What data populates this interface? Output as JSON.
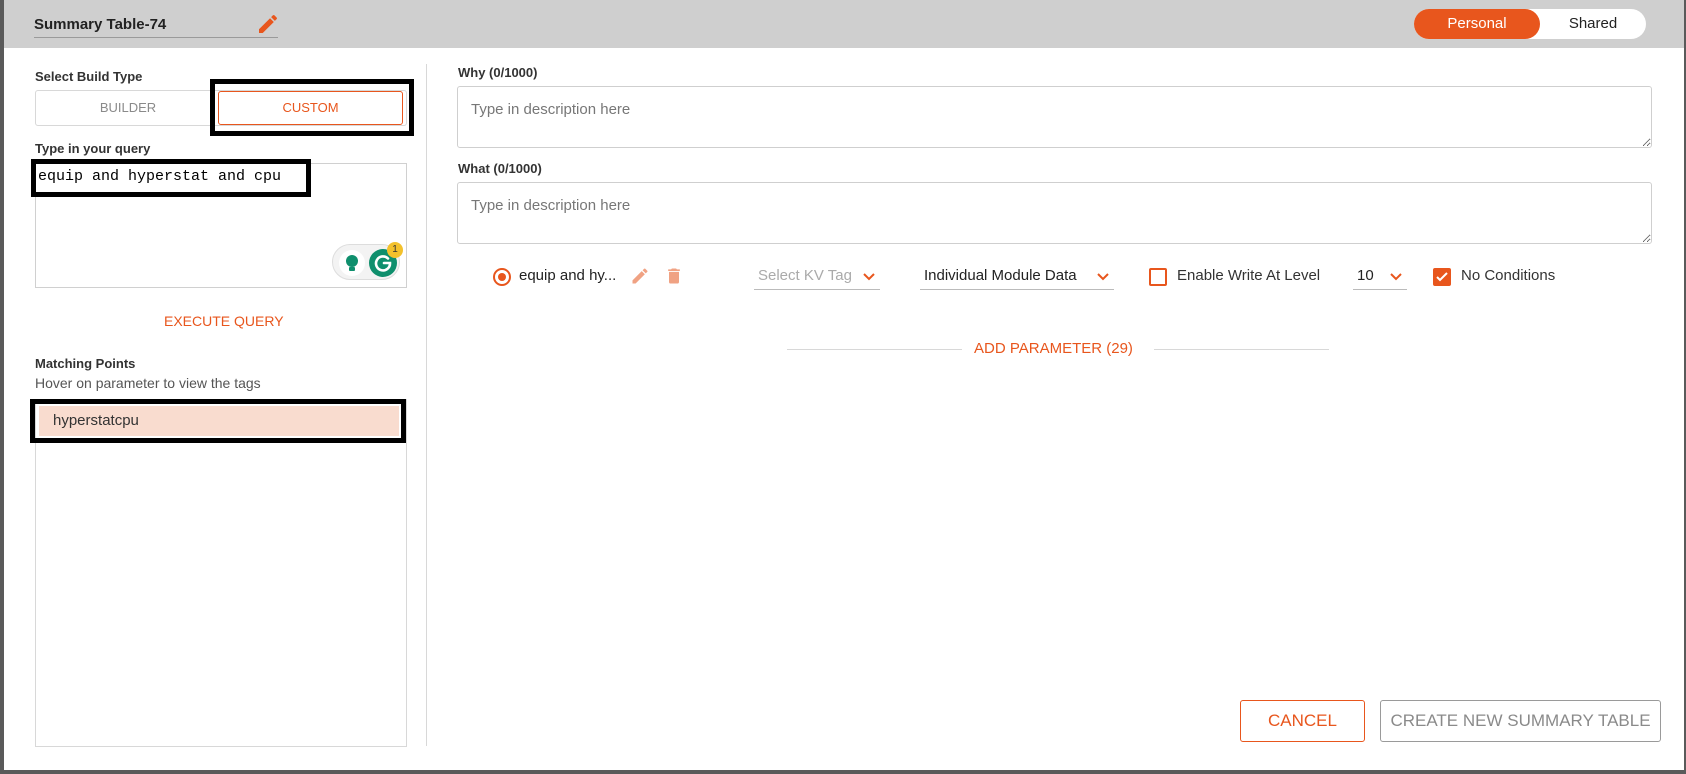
{
  "header": {
    "title": "Summary Table-74",
    "toggle": {
      "active": "Personal",
      "inactive": "Shared"
    }
  },
  "left": {
    "build_type_label": "Select Build Type",
    "builder_label": "BUILDER",
    "custom_label": "CUSTOM",
    "query_label": "Type in your query",
    "query_value": "equip and hyperstat and cpu",
    "grammarly_badge": "1",
    "execute_label": "EXECUTE QUERY",
    "matching_label": "Matching Points",
    "matching_hint": "Hover on parameter to view the tags",
    "points": [
      "hyperstatcpu"
    ]
  },
  "right": {
    "why_label": "Why (0/1000)",
    "why_placeholder": "Type in description here",
    "what_label": "What (0/1000)",
    "what_placeholder": "Type in description here",
    "parameter": {
      "name": "equip and hy...",
      "kv_tag_placeholder": "Select KV Tag",
      "data_type": "Individual Module Data",
      "enable_write_label": "Enable Write At Level",
      "write_level": "10",
      "no_conditions_label": "No Conditions"
    },
    "add_parameter_label": "ADD PARAMETER (29)"
  },
  "footer": {
    "cancel_label": "CANCEL",
    "create_label": "CREATE NEW SUMMARY TABLE"
  },
  "colors": {
    "accent": "#e8561d",
    "highlight": "#f9dccf",
    "topbar": "#cfcfcf"
  }
}
